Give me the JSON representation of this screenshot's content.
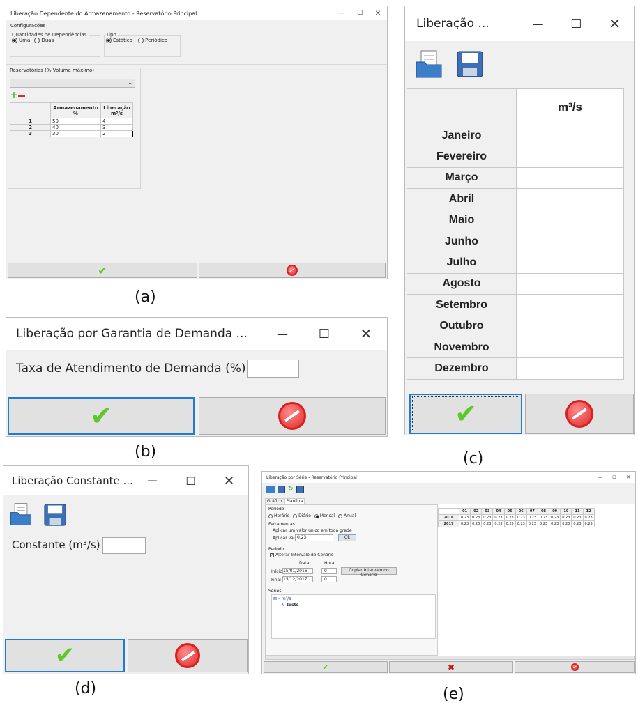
{
  "a": {
    "title": "Liberação Dependente do Armazenamento - Reservatório Principal",
    "menu": "Configurações",
    "deps_legend": "Quantidades de Dependências",
    "deps_opt1": "Uma",
    "deps_opt2": "Duas",
    "tipo_legend": "Tipo",
    "tipo_opt1": "Estático",
    "tipo_opt2": "Periódico",
    "reservoirs_label": "Reservatórios (% Volume máximo)",
    "col1": "Armazenamento %",
    "col2": "Liberação m³/s",
    "rows": [
      {
        "n": "1",
        "arm": "50",
        "lib": "4"
      },
      {
        "n": "2",
        "arm": "40",
        "lib": "3"
      },
      {
        "n": "3",
        "arm": "30",
        "lib": "2"
      }
    ],
    "caption": "(a)"
  },
  "b": {
    "title": "Liberação por Garantia de Demanda ...",
    "field_label": "Taxa de Atendimento de Demanda (%)",
    "caption": "(b)"
  },
  "c": {
    "title": "Liberação ...",
    "col_header": "m³/s",
    "months": [
      "Janeiro",
      "Fevereiro",
      "Março",
      "Abril",
      "Maio",
      "Junho",
      "Julho",
      "Agosto",
      "Setembro",
      "Outubro",
      "Novembro",
      "Dezembro"
    ],
    "caption": "(c)"
  },
  "d": {
    "title": "Liberação Constante ...",
    "field_label": "Constante (m³/s)",
    "caption": "(d)"
  },
  "e": {
    "title": "Liberação por Série - Reservatório Principal",
    "tab1": "Gráfico",
    "tab2": "Planilha",
    "periodo_legend": "Período",
    "periodo_opts": [
      "Horário",
      "Diário",
      "Mensal",
      "Anual"
    ],
    "ferramentas_legend": "Ferramentas",
    "aplicar_legend": "Aplicar um valor único em toda grade",
    "aplicar_label": "Aplicar valor:",
    "aplicar_value": "0.23",
    "ok_label": "Ok",
    "periodo2_legend": "Período",
    "alterar_label": "Alterar Intervalo do Cenário",
    "data_hdr": "Data",
    "hora_hdr": "Hora",
    "inicio_label": "Início",
    "inicio_date": "15/01/2016",
    "inicio_hora": "0",
    "final_label": "Final",
    "final_date": "15/12/2017",
    "final_hora": "0",
    "copiar_label": "Copiar Intervalo do Cenário",
    "series_legend": "Séries",
    "tree_root": "m³/s",
    "tree_child": "teste",
    "months": [
      "01",
      "02",
      "03",
      "04",
      "05",
      "06",
      "07",
      "08",
      "09",
      "10",
      "11",
      "12"
    ],
    "years": [
      "2016",
      "2017"
    ],
    "cell_value": "0.23",
    "caption": "(e)"
  },
  "colors": {
    "check": "#5ec72a",
    "cancel": "#d91f1f",
    "select_border": "#1e7bd6",
    "x_red": "#cc1111"
  }
}
